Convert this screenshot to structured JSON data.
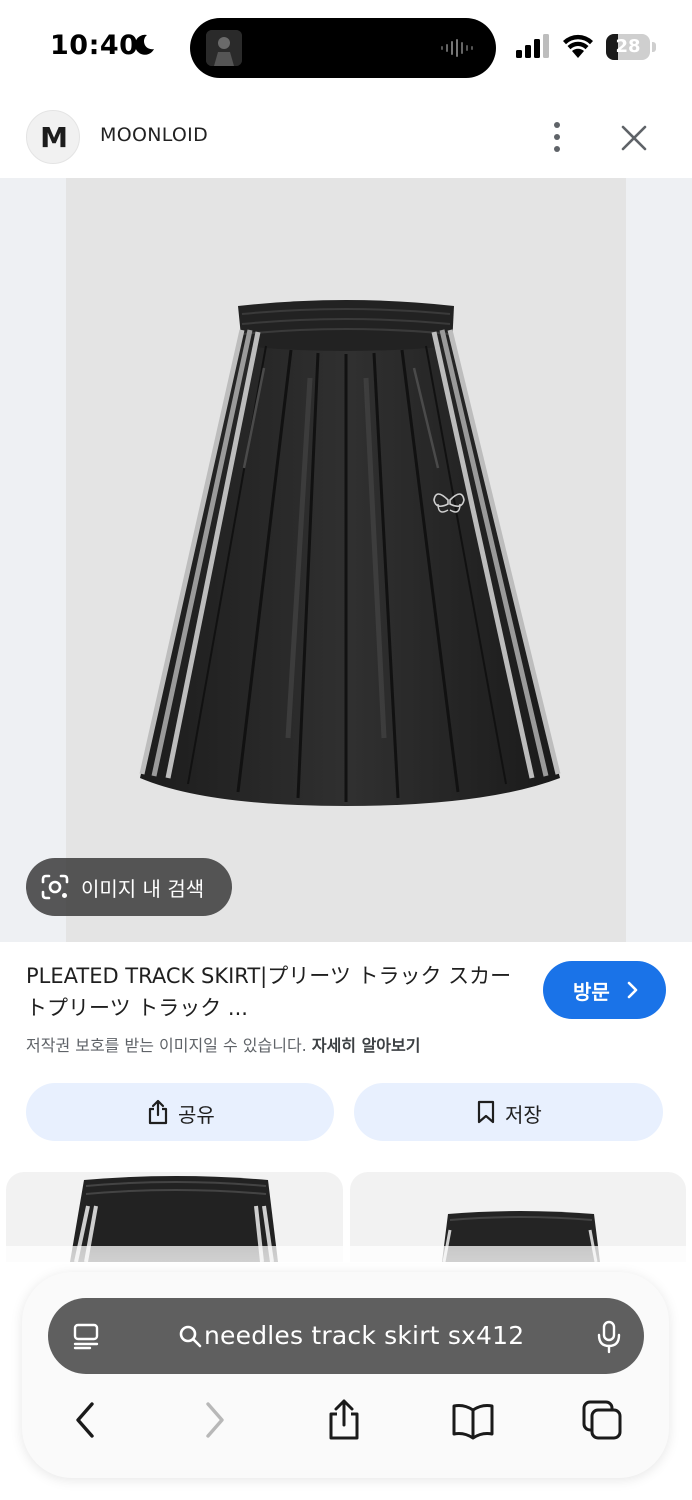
{
  "status_bar": {
    "time": "10:40",
    "battery_level": "28"
  },
  "source": {
    "logo_letter": "M",
    "name": "MOONLOID"
  },
  "image": {
    "lens_label": "이미지 내 검색"
  },
  "result": {
    "title": "PLEATED TRACK SKIRT|プリーツ トラック スカートプリーツ トラック ...",
    "visit_label": "방문",
    "copyright_notice": "저작권 보호를 받는 이미지일 수 있습니다.",
    "learn_more_label": "자세히 알아보기",
    "share_label": "공유",
    "save_label": "저장"
  },
  "browser": {
    "url_query": "needles track skirt sx412"
  },
  "colors": {
    "accent": "#1a73e8",
    "action_button_bg": "#e8f0fe",
    "url_bar_bg": "#5f5f5f"
  },
  "icons": {
    "status": [
      "moon-icon",
      "cellular-signal-icon",
      "wifi-icon",
      "battery-icon"
    ],
    "header": [
      "more-vertical-icon",
      "close-icon"
    ],
    "lens": "google-lens-icon",
    "share": "share-icon",
    "save": "bookmark-icon",
    "toolbar": [
      "tab-overview-icon",
      "search-icon",
      "microphone-icon",
      "back-arrow-icon",
      "forward-arrow-icon",
      "share-icon",
      "bookmarks-icon",
      "tabs-icon"
    ]
  }
}
